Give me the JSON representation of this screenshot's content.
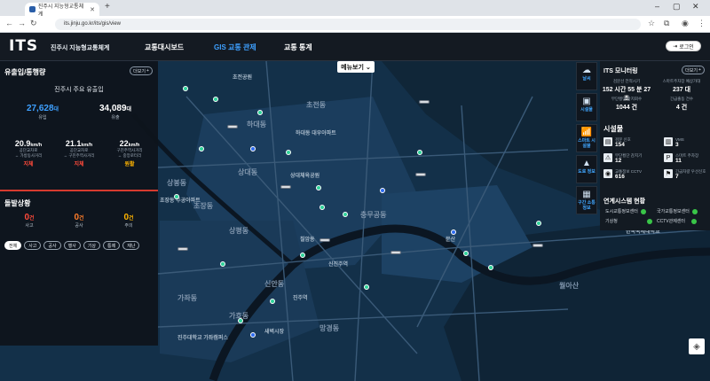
{
  "browser": {
    "tab_title": "진주시 지능형교통체계",
    "new_tab": "+",
    "url": "its.jinju.go.kr/its/gis/view",
    "win_controls": [
      "–",
      "▢",
      "✕"
    ]
  },
  "header": {
    "logo": "ITS",
    "logo_sub": "진주시 지능형교통체계",
    "menu": [
      "교통대시보드",
      "GIS 교통 관제",
      "교통 통계"
    ],
    "active_menu": "GIS 교통 관제",
    "login": "로그인"
  },
  "map": {
    "menu_button": "메뉴보기",
    "labels": [
      "초전공원",
      "하대동",
      "하대동 대우아파트",
      "상대동",
      "상대체육공원",
      "초장동",
      "초전동",
      "상평동",
      "신안동",
      "충무공동",
      "가좌동",
      "칠암동",
      "문산",
      "월아산",
      "새벽시장",
      "신진주역",
      "가호동",
      "진주역",
      "진주대학교 가좌캠퍼스",
      "한국국제대학교",
      "상봉동",
      "망경동",
      "초장동 주공아파트"
    ]
  },
  "left_panel": {
    "flow_title": "유출입/통행량",
    "more": "더보기",
    "flow_subtitle": "진주시 주요 유출입",
    "inflow": {
      "value": "27,628",
      "unit": "대",
      "label": "유입"
    },
    "outflow": {
      "value": "34,089",
      "unit": "대",
      "label": "유출"
    },
    "speeds": [
      {
        "value": "20.9",
        "unit": "km/h",
        "line1": "공단교차로",
        "line2": "↔ 가방동사거리",
        "status": "지체",
        "color": "#ff4a3a"
      },
      {
        "value": "21.1",
        "unit": "km/h",
        "line1": "공단교차로",
        "line2": "↔ 구진주역사거리",
        "status": "지체",
        "color": "#ff4a3a"
      },
      {
        "value": "22",
        "unit": "km/h",
        "line1": "구진주역사거리",
        "line2": "↔ 중앙로터리",
        "status": "원활",
        "color": "#ffb400"
      }
    ],
    "events_title": "돌발상황",
    "events": [
      {
        "value": "0",
        "unit": "건",
        "label": "사고",
        "color": "#ff4a3a"
      },
      {
        "value": "0",
        "unit": "건",
        "label": "공사",
        "color": "#ff7d2a"
      },
      {
        "value": "0",
        "unit": "건",
        "label": "주의",
        "color": "#ffb400"
      }
    ],
    "filters": [
      "전체",
      "사고",
      "공사",
      "행사",
      "기상",
      "통제",
      "재난"
    ]
  },
  "side_buttons": [
    {
      "icon": "☁",
      "label": "날씨"
    },
    {
      "icon": "▣",
      "label": "시설물"
    },
    {
      "icon": "📶",
      "label": "스마트 시설물"
    },
    {
      "icon": "▲",
      "label": "도로 정보"
    },
    {
      "icon": "▦",
      "label": "구간 소통정보"
    }
  ],
  "right_panel": {
    "title": "ITS 모니터링",
    "more": "더보기",
    "monitors": [
      {
        "label": "검문선 전적시기",
        "value": "152 시간 55 분 27 초"
      },
      {
        "label": "스마트주차장 예상가대",
        "value": "237 대"
      },
      {
        "label": "무단횡단 감지회수",
        "value": "1044 건"
      },
      {
        "label": "긴급출동 건수",
        "value": "4 건"
      }
    ],
    "fac_title": "시설물",
    "facilities": [
      {
        "icon": "▤",
        "label": "검문 신호",
        "value": "154"
      },
      {
        "icon": "▥",
        "label": "VMS",
        "value": "3"
      },
      {
        "icon": "⚠",
        "label": "무단횡단 감지기",
        "value": "12"
      },
      {
        "icon": "P",
        "label": "스마트 주차장",
        "value": "11"
      },
      {
        "icon": "◉",
        "label": "교통정보 CCTV",
        "value": "616"
      },
      {
        "icon": "⚑",
        "label": "긴급차량 우선신호",
        "value": "7"
      }
    ],
    "link_title": "연계시스템 현황",
    "links": [
      "도시교통정보센터",
      "국가교통정보센터",
      "기상청",
      "CCTV관제센터"
    ]
  }
}
